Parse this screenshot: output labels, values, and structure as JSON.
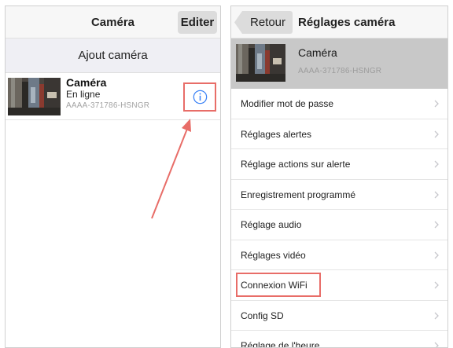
{
  "left": {
    "nav_title": "Caméra",
    "edit_label": "Editer",
    "section_header": "Ajout caméra",
    "camera": {
      "name": "Caméra",
      "status": "En ligne",
      "id": "AAAA-371786-HSNGR"
    }
  },
  "right": {
    "back_label": "Retour",
    "nav_title": "Réglages caméra",
    "camera": {
      "name": "Caméra",
      "id": "AAAA-371786-HSNGR"
    },
    "menu": [
      {
        "label": "Modifier mot de passe"
      },
      {
        "label": "Réglages alertes"
      },
      {
        "label": "Réglage actions sur alerte"
      },
      {
        "label": "Enregistrement programmé"
      },
      {
        "label": "Réglage audio"
      },
      {
        "label": "Réglages vidéo"
      },
      {
        "label": "Connexion WiFi",
        "highlighted": true
      },
      {
        "label": "Config SD"
      },
      {
        "label": "Réglage de l'heure"
      }
    ]
  },
  "colors": {
    "annotation": "#e86d68",
    "info_icon": "#3b82f6",
    "nav_bg": "#f7f7f7",
    "section_bg": "#efeff4"
  },
  "icons": [
    "info-icon",
    "chevron-right-icon",
    "back-arrow-icon",
    "annotation-arrow"
  ]
}
